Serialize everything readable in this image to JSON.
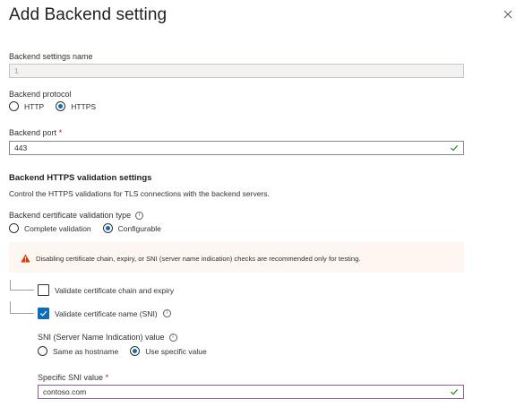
{
  "header": {
    "title": "Add Backend setting",
    "close_icon": "close-icon"
  },
  "settings_name": {
    "label": "Backend settings name",
    "value": "1"
  },
  "protocol": {
    "label": "Backend protocol",
    "options": [
      "HTTP",
      "HTTPS"
    ],
    "selected": "HTTPS"
  },
  "port": {
    "label": "Backend port",
    "required_mark": "*",
    "value": "443"
  },
  "https_validation": {
    "heading": "Backend HTTPS validation settings",
    "description": "Control the HTTPS validations for TLS connections with the backend servers.",
    "cert_type_label": "Backend certificate validation type",
    "options": [
      "Complete validation",
      "Configurable"
    ],
    "selected": "Configurable",
    "warning": "Disabling certificate chain, expiry, or SNI (server name indication) checks are recommended only for testing.",
    "validate_chain": {
      "label": "Validate certificate chain and expiry",
      "checked": false
    },
    "validate_name": {
      "label": "Validate certificate name (SNI)",
      "checked": true
    },
    "sni": {
      "label": "SNI (Server Name Indication) value",
      "options": [
        "Same as hostname",
        "Use specific value"
      ],
      "selected": "Use specific value",
      "specific_label": "Specific SNI value",
      "required_mark": "*",
      "specific_value": "contoso.com"
    }
  },
  "info_glyph": "i",
  "colors": {
    "accent": "#0f6cbd",
    "success": "#107c10",
    "warning": "#d83b01",
    "warning_bg": "#fdf6f1",
    "required": "#a4262c"
  }
}
